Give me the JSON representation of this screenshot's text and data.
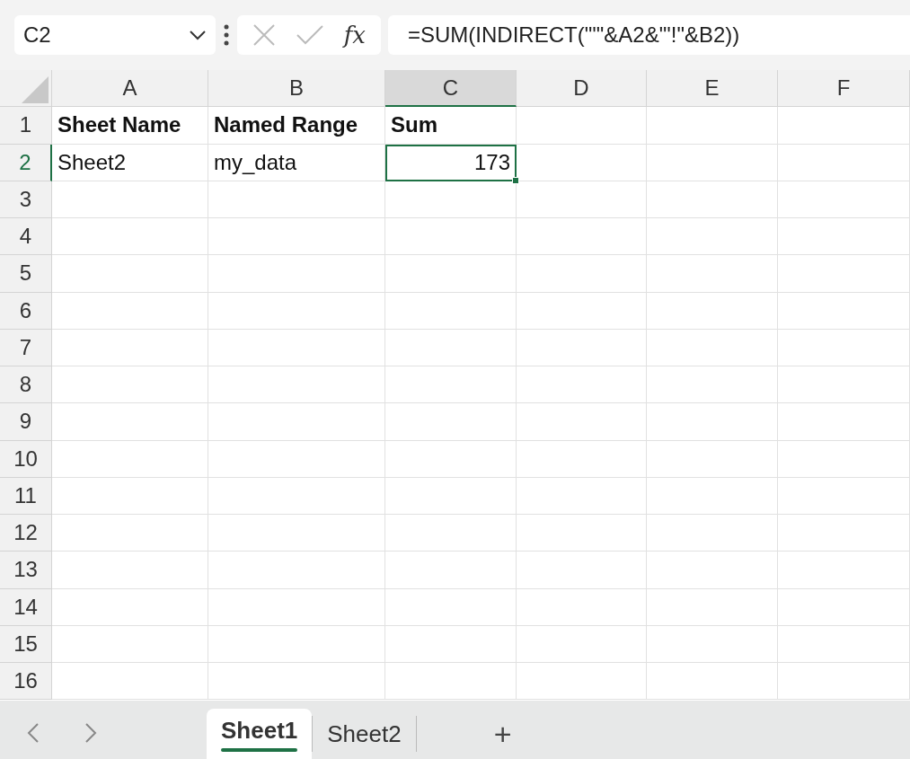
{
  "name_box": {
    "value": "C2"
  },
  "formula_bar": {
    "fx_label": "fx",
    "formula": "=SUM(INDIRECT(\"'\"&A2&\"'!\"&B2))"
  },
  "columns": [
    {
      "label": "A",
      "selected": false
    },
    {
      "label": "B",
      "selected": false
    },
    {
      "label": "C",
      "selected": true
    },
    {
      "label": "D",
      "selected": false
    },
    {
      "label": "E",
      "selected": false
    },
    {
      "label": "F",
      "selected": false
    }
  ],
  "rows": [
    {
      "number": "1",
      "selected": false,
      "cells": [
        {
          "text": "Sheet Name",
          "kind": "header",
          "selected": false
        },
        {
          "text": "Named Range",
          "kind": "header",
          "selected": false
        },
        {
          "text": "Sum",
          "kind": "header",
          "selected": false
        }
      ]
    },
    {
      "number": "2",
      "selected": true,
      "cells": [
        {
          "text": "Sheet2",
          "kind": "text",
          "selected": false
        },
        {
          "text": "my_data",
          "kind": "text",
          "selected": false
        },
        {
          "text": "173",
          "kind": "number",
          "selected": true
        }
      ]
    },
    {
      "number": "3",
      "selected": false
    },
    {
      "number": "4",
      "selected": false
    },
    {
      "number": "5",
      "selected": false
    },
    {
      "number": "6",
      "selected": false
    },
    {
      "number": "7",
      "selected": false
    },
    {
      "number": "8",
      "selected": false
    },
    {
      "number": "9",
      "selected": false
    },
    {
      "number": "10",
      "selected": false
    },
    {
      "number": "11",
      "selected": false
    },
    {
      "number": "12",
      "selected": false
    },
    {
      "number": "13",
      "selected": false
    },
    {
      "number": "14",
      "selected": false
    },
    {
      "number": "15",
      "selected": false
    },
    {
      "number": "16",
      "selected": false
    }
  ],
  "sheet_tabs": [
    {
      "label": "Sheet1",
      "selected": true
    },
    {
      "label": "Sheet2",
      "selected": false
    }
  ],
  "add_sheet": "+"
}
